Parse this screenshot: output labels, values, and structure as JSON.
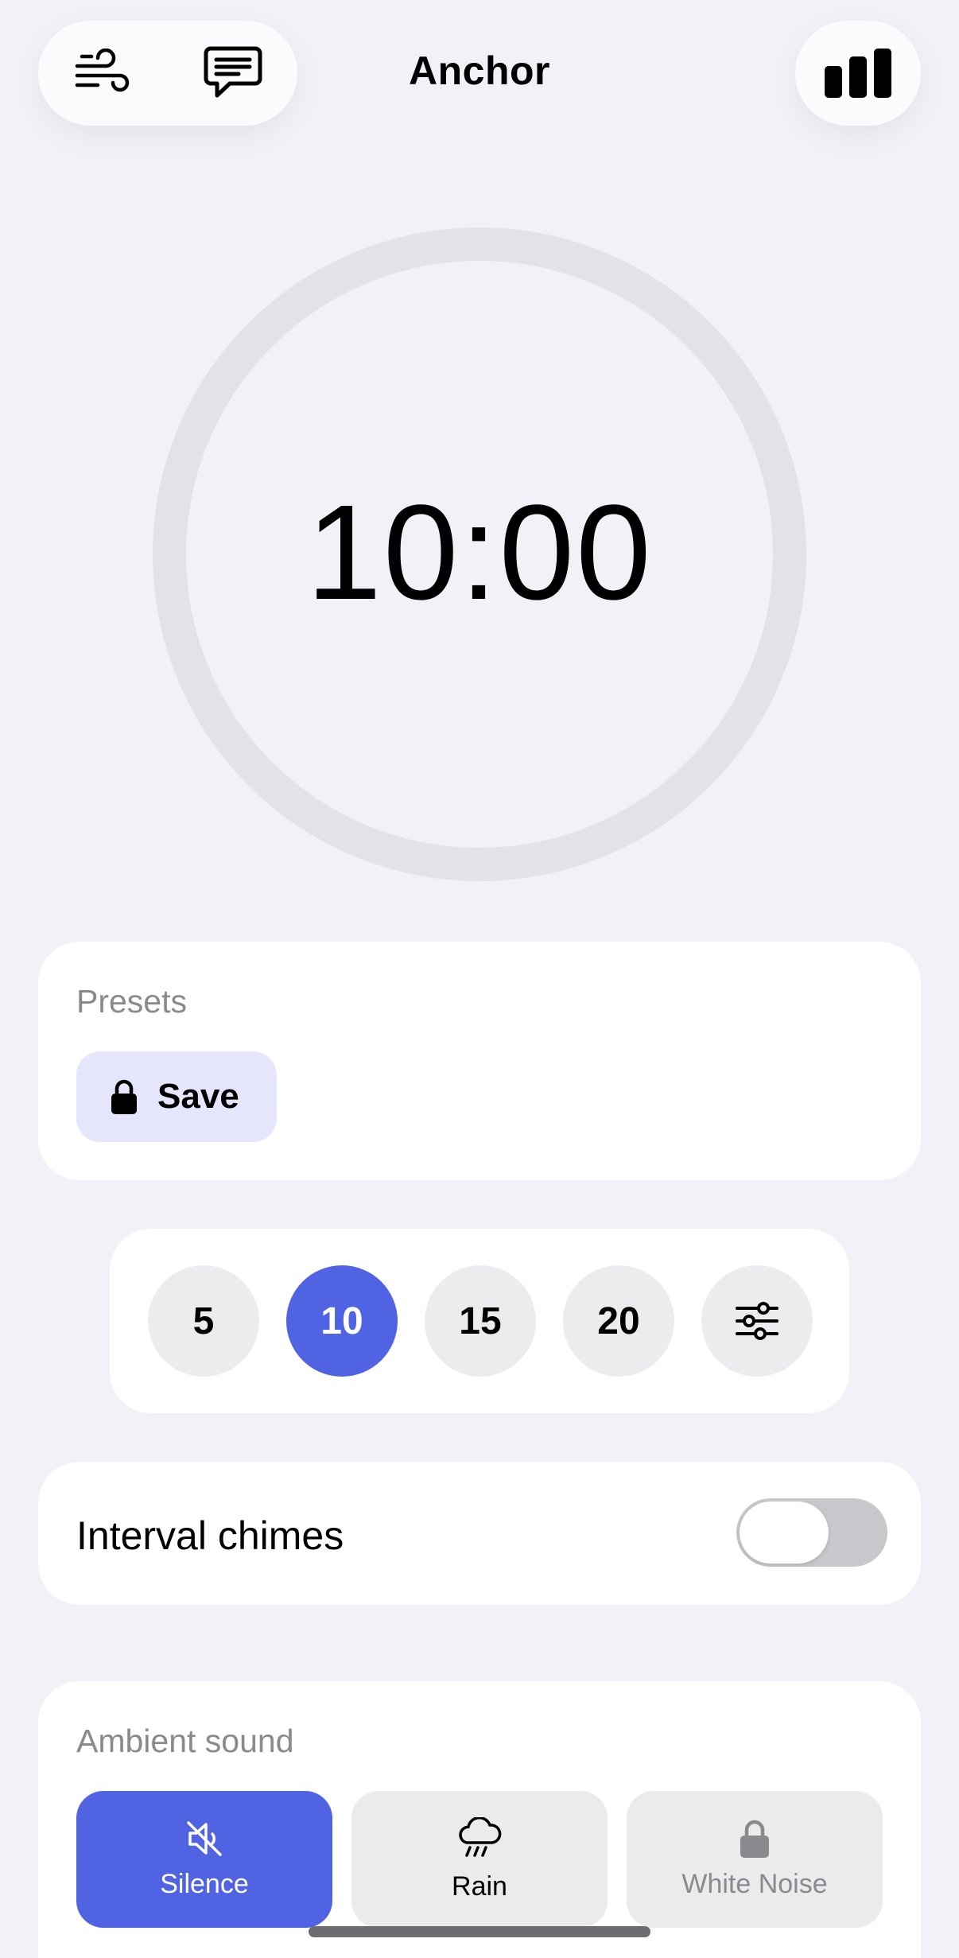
{
  "header": {
    "title": "Anchor",
    "left_icons": [
      "wind-icon",
      "chat-bubble-icon"
    ],
    "right_icon": "bar-chart-icon"
  },
  "timer": {
    "display": "10:00"
  },
  "presets": {
    "label": "Presets",
    "save_label": "Save",
    "save_icon": "lock-icon"
  },
  "durations": {
    "options": [
      "5",
      "10",
      "15",
      "20"
    ],
    "selected": "10",
    "settings_icon": "sliders-icon"
  },
  "interval_chimes": {
    "label": "Interval chimes",
    "enabled": false
  },
  "ambient": {
    "label": "Ambient sound",
    "options": [
      {
        "label": "Silence",
        "icon": "speaker-muted-icon",
        "selected": true,
        "locked": false
      },
      {
        "label": "Rain",
        "icon": "rain-cloud-icon",
        "selected": false,
        "locked": false
      },
      {
        "label": "White Noise",
        "icon": "lock-icon",
        "selected": false,
        "locked": true
      }
    ]
  },
  "colors": {
    "accent": "#4f63e3",
    "background": "#f2f1f7",
    "card": "#ffffff",
    "secondary_text": "#8a8a8e"
  }
}
